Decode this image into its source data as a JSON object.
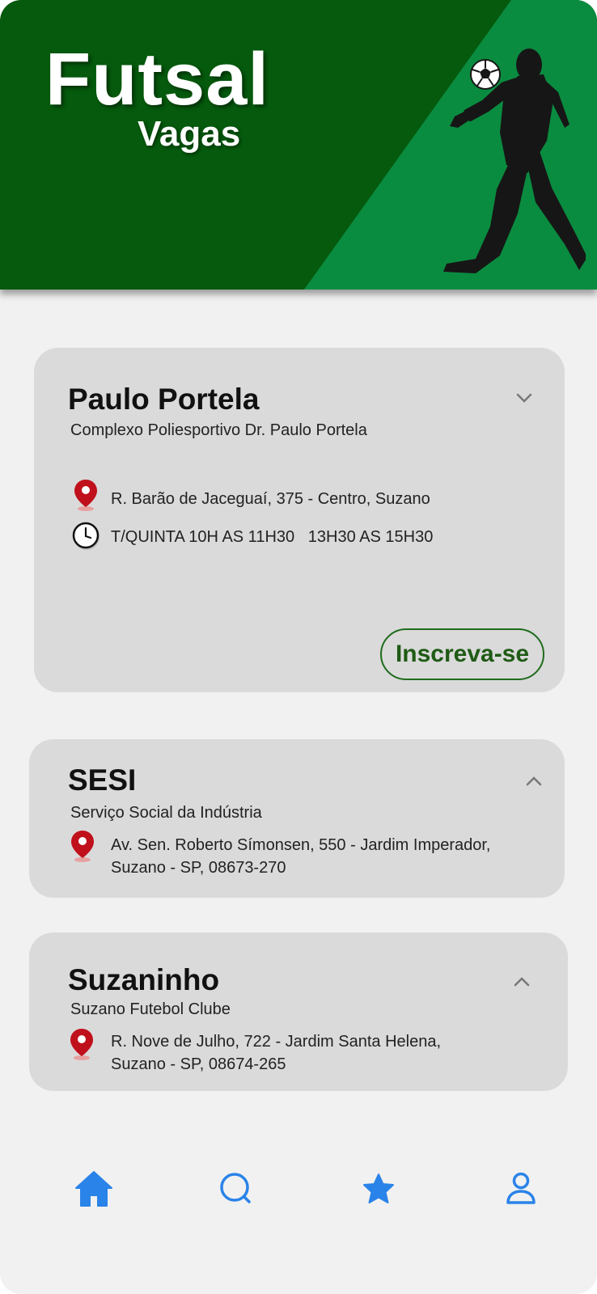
{
  "header": {
    "title": "Futsal",
    "subtitle": "Vagas"
  },
  "cards": [
    {
      "title": "Paulo Portela",
      "subtitle": "Complexo Poliesportivo Dr. Paulo Portela",
      "address": "R. Barão de Jaceguaí, 375 - Centro, Suzano",
      "schedule": "T/QUINTA 10H AS 11H30   13H30 AS 15H30",
      "button_label": "Inscreva-se",
      "expanded": true
    },
    {
      "title": "SESI",
      "subtitle": "Serviço Social da Indústria",
      "address_line1": "Av. Sen. Roberto Símonsen, 550 - Jardim Imperador,",
      "address_line2": "Suzano - SP, 08673-270",
      "expanded": false
    },
    {
      "title": "Suzaninho",
      "subtitle": "Suzano Futebol Clube",
      "address_line1": "R. Nove de Julho, 722 - Jardim Santa Helena,",
      "address_line2": "Suzano - SP, 08674-265",
      "expanded": false
    }
  ],
  "nav": {
    "items": [
      {
        "icon": "home-icon",
        "active": true
      },
      {
        "icon": "search-icon",
        "active": false
      },
      {
        "icon": "star-icon",
        "active": false
      },
      {
        "icon": "user-icon",
        "active": false
      }
    ]
  },
  "colors": {
    "header_dark_green": "#055a0d",
    "header_light_green": "#0a8c40",
    "card_bg": "#dadada",
    "pin_red": "#c0101b",
    "button_green": "#1f5b15",
    "nav_blue": "#2a83e8"
  }
}
